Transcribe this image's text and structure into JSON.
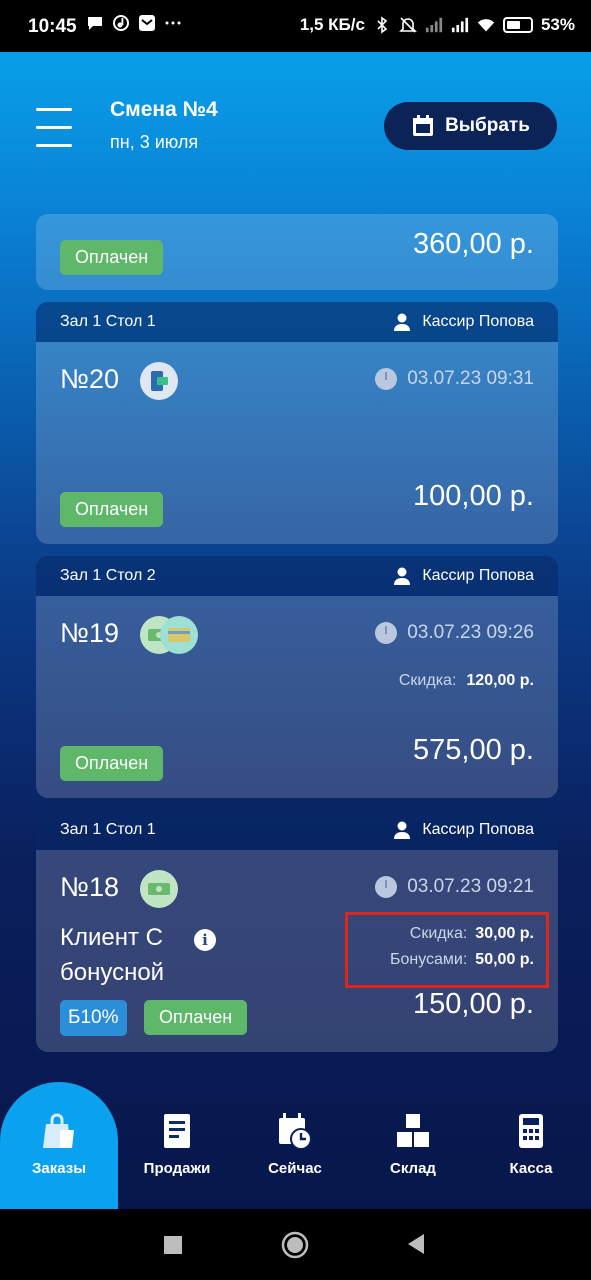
{
  "status_bar": {
    "time": "10:45",
    "speed": "1,5 КБ/с",
    "battery": "53%",
    "icons": [
      "chat-icon",
      "tiktok-icon",
      "mail-icon",
      "more-icon",
      "bluetooth-icon",
      "mute-icon",
      "signal-icon",
      "signal-icon",
      "wifi-icon",
      "battery-icon"
    ]
  },
  "header": {
    "title": "Смена №4",
    "date": "пн, 3 июля",
    "choose_label": "Выбрать"
  },
  "orders": [
    {
      "status": "Оплачен",
      "amount": "360,00 р."
    },
    {
      "location": "Зал 1 Стол 1",
      "cashier": "Кассир Попова",
      "number": "№20",
      "datetime": "03.07.23 09:31",
      "payment_icon": "mobile-payment-icon",
      "status": "Оплачен",
      "amount": "100,00 р."
    },
    {
      "location": "Зал 1 Стол 2",
      "cashier": "Кассир Попова",
      "number": "№19",
      "datetime": "03.07.23 09:26",
      "payment_icon": "cash-and-card-icon",
      "discount_label": "Скидка:",
      "discount_value": "120,00 р.",
      "status": "Оплачен",
      "amount": "575,00 р."
    },
    {
      "location": "Зал 1 Стол 1",
      "cashier": "Кассир Попова",
      "number": "№18",
      "datetime": "03.07.23 09:21",
      "payment_icon": "cash-icon",
      "client": "Клиент С бонусной",
      "discount_label": "Скидка:",
      "discount_value": "30,00 р.",
      "bonus_label": "Бонусами:",
      "bonus_value": "50,00 р.",
      "bonus_badge": "Б10%",
      "status": "Оплачен",
      "amount": "150,00 р."
    }
  ],
  "nav": [
    {
      "label": "Заказы",
      "icon": "shopping-bag-icon",
      "active": true
    },
    {
      "label": "Продажи",
      "icon": "receipt-icon",
      "active": false
    },
    {
      "label": "Сейчас",
      "icon": "calendar-clock-icon",
      "active": false
    },
    {
      "label": "Склад",
      "icon": "boxes-icon",
      "active": false
    },
    {
      "label": "Касса",
      "icon": "cash-register-icon",
      "active": false
    }
  ],
  "colors": {
    "paid_badge": "#5fb76a",
    "bonus_badge": "#2a8ed9",
    "highlight": "#e0251b",
    "active_nav": "#0aa2ef"
  }
}
